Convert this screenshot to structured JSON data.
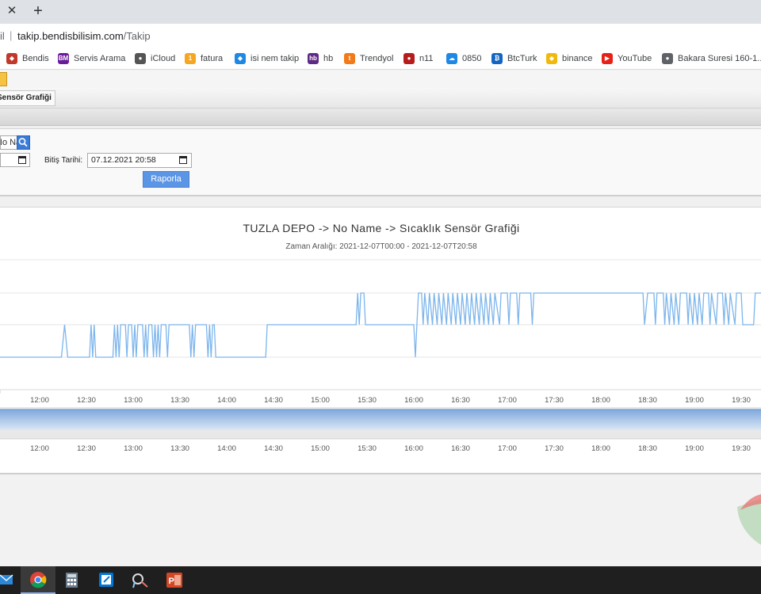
{
  "browser": {
    "close_glyph": "✕",
    "new_tab_glyph": "+",
    "address_prefix": "il",
    "address_sep": "|",
    "address_host": "takip.bendisbilisim.com",
    "address_path": "/Takip"
  },
  "bookmarks": [
    {
      "label": "Bendis",
      "icon": "shield-icon",
      "color": "#c0392b"
    },
    {
      "label": "Servis Arama",
      "icon": "bm-icon",
      "color": "#6a1b9a"
    },
    {
      "label": "iCloud",
      "icon": "apple-icon",
      "color": "#555555"
    },
    {
      "label": "fatura",
      "icon": "coin-icon",
      "color": "#f5a623"
    },
    {
      "label": "isi nem takip",
      "icon": "network-icon",
      "color": "#1e88e5"
    },
    {
      "label": "hb",
      "icon": "hb-icon",
      "color": "#5e2a84"
    },
    {
      "label": "Trendyol",
      "icon": "trendyol-icon",
      "color": "#f27a1a"
    },
    {
      "label": "n11",
      "icon": "bug-icon",
      "color": "#b71c1c"
    },
    {
      "label": "0850",
      "icon": "cloud-icon",
      "color": "#1e88e5"
    },
    {
      "label": "BtcTurk",
      "icon": "btcturk-icon",
      "color": "#1565c0"
    },
    {
      "label": "binance",
      "icon": "binance-icon",
      "color": "#f0b90b"
    },
    {
      "label": "YouTube",
      "icon": "youtube-icon",
      "color": "#e62117"
    },
    {
      "label": "Bakara Suresi 160-1...",
      "icon": "globe-icon",
      "color": "#5f6368"
    }
  ],
  "page": {
    "tab_label": "Sensör Grafiği",
    "device_value": "No Name",
    "end_date_label": "Bitiş Tarihi:",
    "end_date_value": "07.12.2021 20:58",
    "report_button": "Raporla"
  },
  "chart_data": {
    "type": "line",
    "title": "TUZLA DEPO -> No Name -> Sıcaklık Sensör Grafiği",
    "subtitle": "Zaman Aralığı: 2021-12-07T00:00 - 2021-12-07T20:58",
    "x_tick_labels": [
      "12:00",
      "12:30",
      "13:00",
      "13:30",
      "14:00",
      "14:30",
      "15:00",
      "15:30",
      "16:00",
      "16:30",
      "17:00",
      "17:30",
      "18:00",
      "18:30",
      "19:00",
      "19:30"
    ],
    "navigator_tick_labels": [
      "12:00",
      "12:30",
      "13:00",
      "13:30",
      "14:00",
      "14:30",
      "15:00",
      "15:30",
      "16:00",
      "16:30",
      "17:00",
      "17:30",
      "18:00",
      "18:30",
      "19:00",
      "19:30"
    ],
    "x_unit": "minutes since 11:30",
    "levels": [
      0,
      1,
      2
    ],
    "series": [
      {
        "color": "#7cb5ec",
        "points": [
          [
            0,
            0
          ],
          [
            44,
            0
          ],
          [
            46,
            1
          ],
          [
            48,
            0
          ],
          [
            62,
            0
          ],
          [
            63,
            1
          ],
          [
            64,
            0
          ],
          [
            65,
            1
          ],
          [
            66,
            0
          ],
          [
            77,
            0
          ],
          [
            78,
            1
          ],
          [
            79,
            0
          ],
          [
            80,
            1
          ],
          [
            81,
            0
          ],
          [
            82,
            1
          ],
          [
            85,
            1
          ],
          [
            86,
            0
          ],
          [
            87,
            1
          ],
          [
            89,
            1
          ],
          [
            90,
            0
          ],
          [
            91,
            1
          ],
          [
            92,
            0
          ],
          [
            93,
            1
          ],
          [
            96,
            1
          ],
          [
            97,
            0
          ],
          [
            98,
            1
          ],
          [
            99,
            0
          ],
          [
            100,
            1
          ],
          [
            102,
            1
          ],
          [
            103,
            0
          ],
          [
            104,
            1
          ],
          [
            105,
            0
          ],
          [
            106,
            1
          ],
          [
            107,
            0
          ],
          [
            108,
            1
          ],
          [
            111,
            1
          ],
          [
            112,
            0
          ],
          [
            113,
            1
          ],
          [
            126,
            1
          ],
          [
            127,
            0
          ],
          [
            128,
            1
          ],
          [
            129,
            0
          ],
          [
            130,
            1
          ],
          [
            137,
            1
          ],
          [
            138,
            0
          ],
          [
            139,
            1
          ],
          [
            140,
            0
          ],
          [
            141,
            1
          ],
          [
            142,
            1
          ],
          [
            143,
            0
          ],
          [
            175,
            0
          ],
          [
            176,
            1
          ],
          [
            233,
            1
          ],
          [
            234,
            2
          ],
          [
            235,
            1
          ],
          [
            236,
            2
          ],
          [
            238,
            2
          ],
          [
            239,
            1
          ],
          [
            270,
            1
          ],
          [
            271,
            0
          ],
          [
            272,
            1
          ],
          [
            273,
            2
          ],
          [
            275,
            2
          ],
          [
            276,
            1
          ],
          [
            277,
            2
          ],
          [
            279,
            1
          ],
          [
            280,
            2
          ],
          [
            282,
            1
          ],
          [
            283,
            2
          ],
          [
            285,
            1
          ],
          [
            286,
            2
          ],
          [
            288,
            1
          ],
          [
            289,
            2
          ],
          [
            291,
            1
          ],
          [
            292,
            2
          ],
          [
            294,
            1
          ],
          [
            295,
            2
          ],
          [
            297,
            1
          ],
          [
            298,
            2
          ],
          [
            300,
            1
          ],
          [
            301,
            2
          ],
          [
            303,
            1
          ],
          [
            304,
            2
          ],
          [
            306,
            1
          ],
          [
            307,
            2
          ],
          [
            309,
            1
          ],
          [
            310,
            2
          ],
          [
            312,
            1
          ],
          [
            313,
            2
          ],
          [
            315,
            1
          ],
          [
            316,
            2
          ],
          [
            318,
            1
          ],
          [
            319,
            2
          ],
          [
            321,
            1
          ],
          [
            322,
            2
          ],
          [
            325,
            1
          ],
          [
            326,
            2
          ],
          [
            330,
            2
          ],
          [
            331,
            1
          ],
          [
            332,
            2
          ],
          [
            336,
            2
          ],
          [
            337,
            1
          ],
          [
            338,
            2
          ],
          [
            345,
            2
          ],
          [
            346,
            1
          ],
          [
            347,
            2
          ],
          [
            417,
            2
          ],
          [
            418,
            1
          ],
          [
            420,
            2
          ],
          [
            424,
            2
          ],
          [
            425,
            1
          ],
          [
            426,
            2
          ],
          [
            430,
            2
          ],
          [
            431,
            1
          ],
          [
            432,
            2
          ],
          [
            434,
            1
          ],
          [
            435,
            2
          ],
          [
            437,
            1
          ],
          [
            438,
            2
          ],
          [
            440,
            1
          ],
          [
            441,
            2
          ],
          [
            445,
            2
          ],
          [
            446,
            1
          ],
          [
            447,
            2
          ],
          [
            449,
            1
          ],
          [
            450,
            2
          ],
          [
            452,
            1
          ],
          [
            453,
            2
          ],
          [
            455,
            1
          ],
          [
            456,
            2
          ],
          [
            459,
            2
          ],
          [
            460,
            1
          ],
          [
            461,
            2
          ],
          [
            464,
            1
          ],
          [
            465,
            2
          ],
          [
            468,
            2
          ],
          [
            469,
            1
          ],
          [
            470,
            2
          ],
          [
            472,
            1
          ],
          [
            473,
            2
          ],
          [
            476,
            1
          ],
          [
            477,
            2
          ],
          [
            480,
            2
          ],
          [
            481,
            1
          ],
          [
            488,
            1
          ],
          [
            489,
            2
          ],
          [
            490,
            2
          ],
          [
            495,
            2
          ]
        ]
      }
    ]
  }
}
